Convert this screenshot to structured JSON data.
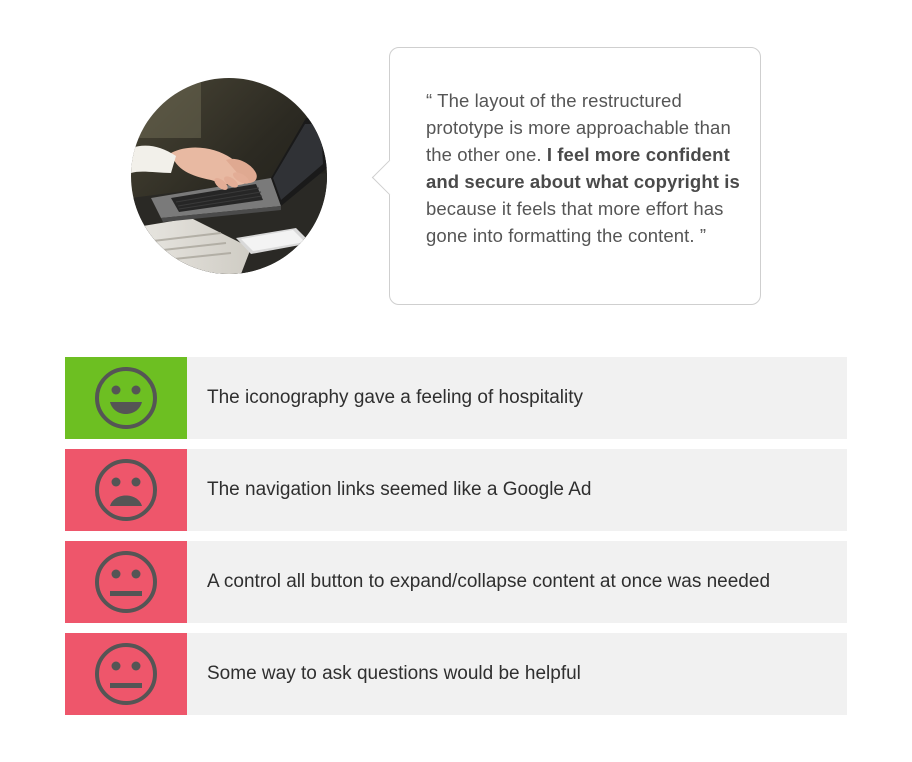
{
  "testimonial": {
    "photo": {
      "alt": "person typing on a laptop"
    },
    "quote": {
      "open_mark": "“",
      "part1": " The layout of the restructured prototype is more approachable than the other one. ",
      "bold": "I feel more confident and secure about what copyright is",
      "part2": " because it feels that more effort has gone into formatting the content. ",
      "close_mark": "”"
    }
  },
  "feedback": {
    "items": [
      {
        "sentiment": "positive",
        "face": "happy-face-icon",
        "color": "#6dbf22",
        "text": "The iconography gave a feeling of hospitality"
      },
      {
        "sentiment": "negative",
        "face": "sad-face-icon",
        "color": "#ee566b",
        "text": "The navigation links seemed like a Google Ad"
      },
      {
        "sentiment": "neutral",
        "face": "neutral-face-icon",
        "color": "#ee566b",
        "text": "A control all button to expand/collapse content at once was needed"
      },
      {
        "sentiment": "neutral",
        "face": "neutral-face-icon",
        "color": "#ee566b",
        "text": "Some way to ask questions would be helpful"
      }
    ]
  },
  "colors": {
    "positive": "#6dbf22",
    "negative": "#ee566b",
    "row_background": "#f1f1f1",
    "face_stroke": "#555555"
  }
}
